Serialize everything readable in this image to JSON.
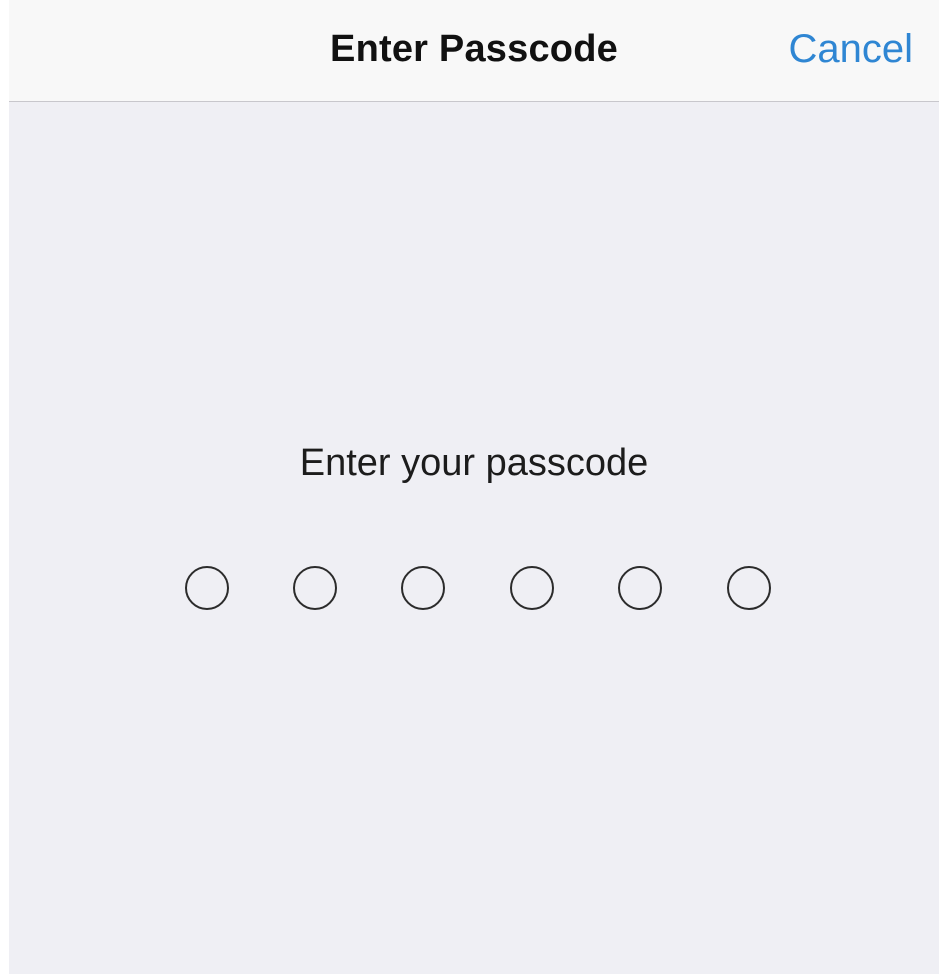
{
  "nav_bar": {
    "title": "Enter Passcode",
    "cancel_label": "Cancel"
  },
  "main": {
    "prompt": "Enter your passcode",
    "passcode": {
      "length": 6,
      "digits_entered": 0
    }
  },
  "colors": {
    "accent": "#2f86d3",
    "background": "#efeff4",
    "nav_background": "#f8f8f8"
  }
}
